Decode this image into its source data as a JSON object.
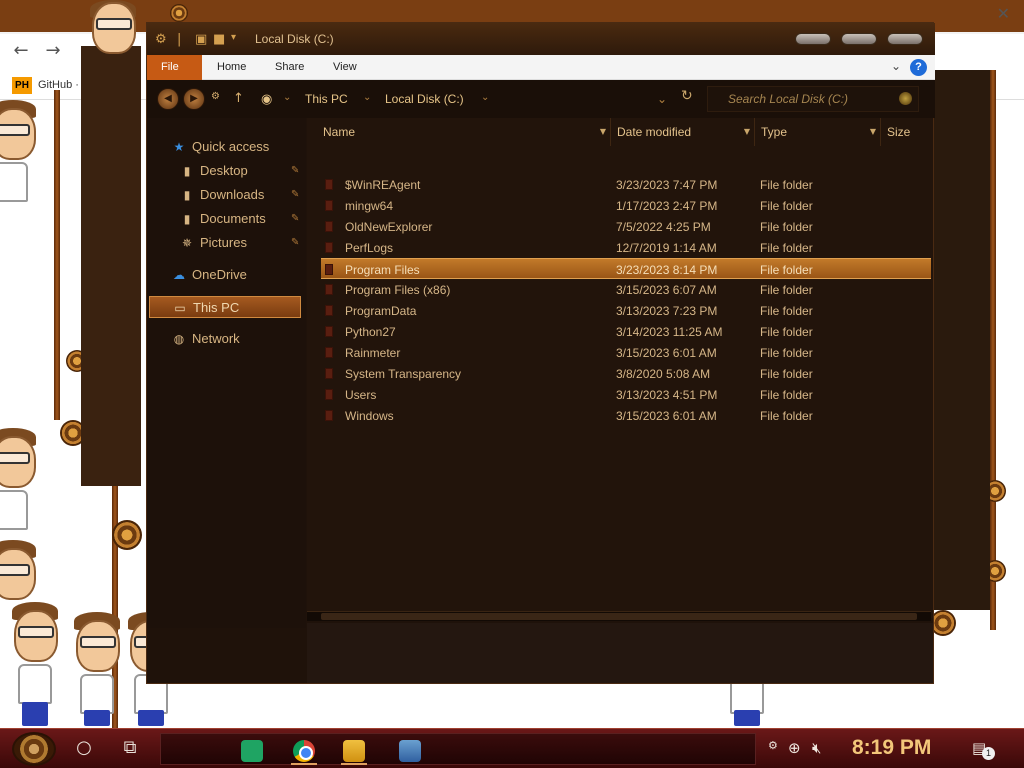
{
  "background_browser": {
    "ph_badge": "PH",
    "bookmark": "GitHub · Exp"
  },
  "window": {
    "title": "Local Disk (C:)"
  },
  "ribbon": {
    "tabs": [
      "File",
      "Home",
      "Share",
      "View"
    ],
    "help": "?"
  },
  "address": {
    "crumbs": [
      "This PC",
      "Local Disk (C:)"
    ],
    "search_placeholder": "Search Local Disk (C:)"
  },
  "nav": {
    "quick_access": "Quick access",
    "desktop": "Desktop",
    "downloads": "Downloads",
    "documents": "Documents",
    "pictures": "Pictures",
    "onedrive": "OneDrive",
    "this_pc": "This PC",
    "network": "Network"
  },
  "columns": {
    "name": "Name",
    "date": "Date modified",
    "type": "Type",
    "size": "Size"
  },
  "files": [
    {
      "name": "$WinREAgent",
      "date": "3/23/2023 7:47 PM",
      "type": "File folder"
    },
    {
      "name": "mingw64",
      "date": "1/17/2023 2:47 PM",
      "type": "File folder"
    },
    {
      "name": "OldNewExplorer",
      "date": "7/5/2022 4:25 PM",
      "type": "File folder"
    },
    {
      "name": "PerfLogs",
      "date": "12/7/2019 1:14 AM",
      "type": "File folder"
    },
    {
      "name": "Program Files",
      "date": "3/23/2023 8:14 PM",
      "type": "File folder"
    },
    {
      "name": "Program Files (x86)",
      "date": "3/15/2023 6:07 AM",
      "type": "File folder"
    },
    {
      "name": "ProgramData",
      "date": "3/13/2023 7:23 PM",
      "type": "File folder"
    },
    {
      "name": "Python27",
      "date": "3/14/2023 11:25 AM",
      "type": "File folder"
    },
    {
      "name": "Rainmeter",
      "date": "3/15/2023 6:01 AM",
      "type": "File folder"
    },
    {
      "name": "System Transparency",
      "date": "3/8/2020 5:08 AM",
      "type": "File folder"
    },
    {
      "name": "Users",
      "date": "3/13/2023 4:51 PM",
      "type": "File folder"
    },
    {
      "name": "Windows",
      "date": "3/15/2023 6:01 AM",
      "type": "File folder"
    }
  ],
  "taskbar": {
    "clock": "8:19 PM",
    "notification_count": "1"
  },
  "colors": {
    "selection": "#c27a2a",
    "ribbon_file_tab": "#c65a14",
    "clock": "#f3c77a"
  }
}
